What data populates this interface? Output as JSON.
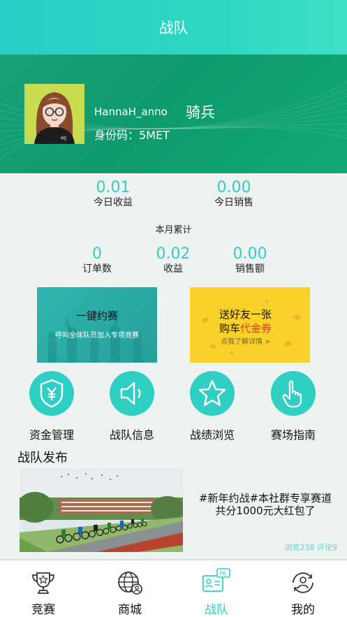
{
  "header": {
    "title": "战队"
  },
  "profile": {
    "username": "HannaH_anno",
    "role": "骑兵",
    "id_code": "身份码：5MET",
    "avatar_badge": "MJ"
  },
  "daily": [
    {
      "value": "0.01",
      "label": "今日收益"
    },
    {
      "value": "0.00",
      "label": "今日销售"
    }
  ],
  "monthly": {
    "title": "本月累计",
    "stats": [
      {
        "value": "0",
        "label": "订单数"
      },
      {
        "value": "0.02",
        "label": "收益"
      },
      {
        "value": "0.00",
        "label": "销售额"
      }
    ]
  },
  "promos": {
    "left": {
      "title": "一键约赛",
      "subtitle": "呼叫全体队员加入专项竞赛"
    },
    "right": {
      "line1": "送好友一张",
      "line2_prefix": "购车",
      "line2_highlight": "代金券",
      "line3": "点我了解详情 >",
      "highlight_color": "#e53a1e"
    }
  },
  "actions": [
    {
      "label": "资金管理",
      "icon": "yen-shield-icon"
    },
    {
      "label": "战队信息",
      "icon": "speaker-icon"
    },
    {
      "label": "战绩浏览",
      "icon": "star-icon"
    },
    {
      "label": "赛场指南",
      "icon": "pointing-hand-icon"
    }
  ],
  "feed": {
    "section_title": "战队发布",
    "post": {
      "line1": "#新年约战#本社群专享赛道",
      "line2": "共分1000元大红包了",
      "meta": "浏览238 评论9"
    }
  },
  "tabbar": {
    "items": [
      {
        "label": "竞赛",
        "icon": "trophy-icon",
        "active": false
      },
      {
        "label": "商城",
        "icon": "globe-user-icon",
        "active": false
      },
      {
        "label": "战队",
        "icon": "team-pk-icon",
        "active": true,
        "badge": "PK"
      },
      {
        "label": "我的",
        "icon": "user-cycle-icon",
        "active": false
      }
    ]
  },
  "colors": {
    "accent": "#2fcfc4",
    "banner_green": "#0d9a6d",
    "promo_yellow": "#f8d22a"
  }
}
